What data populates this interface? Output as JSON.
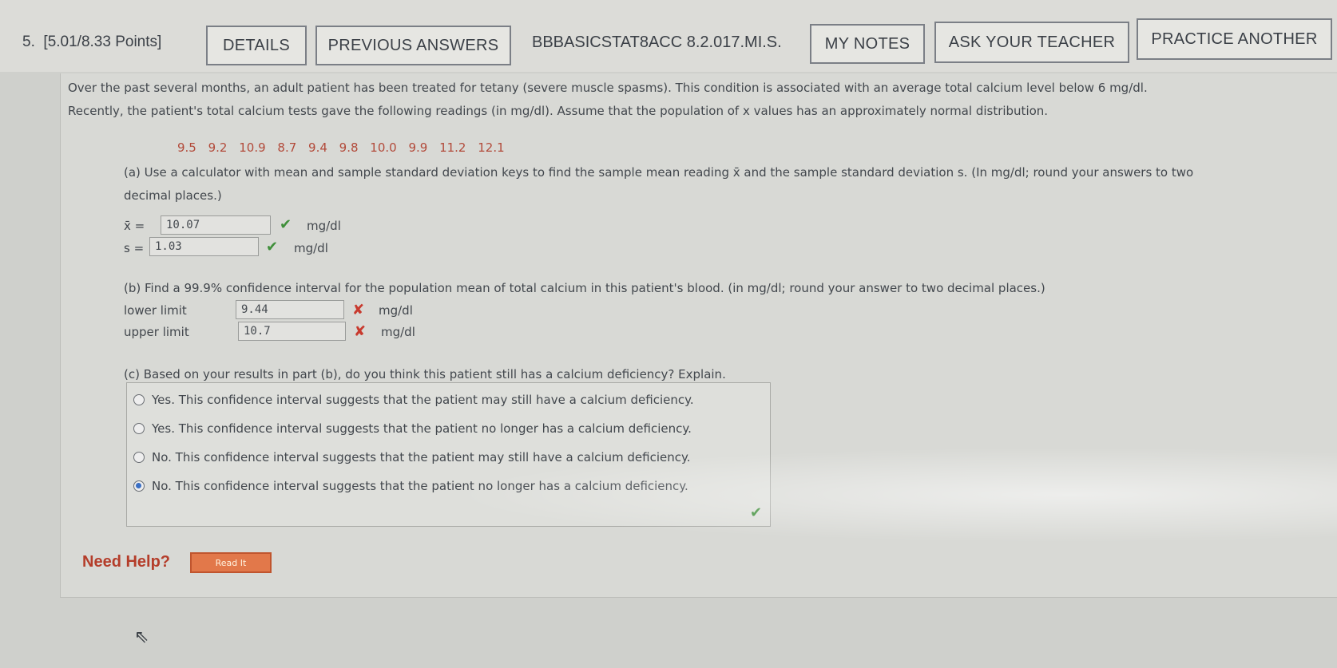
{
  "header": {
    "question_number": "5.",
    "points": "[5.01/8.33 Points]",
    "details_label": "DETAILS",
    "previous_answers_label": "PREVIOUS ANSWERS",
    "code": "BBBASICSTAT8ACC 8.2.017.MI.S.",
    "my_notes_label": "MY NOTES",
    "ask_teacher_label": "ASK YOUR TEACHER",
    "practice_another_label": "PRACTICE ANOTHER"
  },
  "problem": {
    "line1": "Over the past several months, an adult patient has been treated for tetany (severe muscle spasms). This condition is associated with an average total calcium level below 6 mg/dl.",
    "line2": "Recently, the patient's total calcium tests gave the following readings (in mg/dl). Assume that the population of x values has an approximately normal distribution.",
    "data_values": "9.5  9.2  10.9  8.7  9.4  9.8  10.0  9.9  11.2  12.1"
  },
  "part_a": {
    "line1": "(a) Use a calculator with mean and sample standard deviation keys to find the sample mean reading x̄ and the sample standard deviation s. (In mg/dl; round your answers to two",
    "line2": "decimal places.)",
    "xbar_label": "x̄ =",
    "xbar_value": "10.07",
    "s_label": "s =",
    "s_value": "1.03",
    "unit": "mg/dl"
  },
  "part_b": {
    "question": "(b) Find a 99.9% confidence interval for the population mean of total calcium in this patient's blood. (in mg/dl; round your answer to two decimal places.)",
    "lower_label": "lower limit",
    "lower_value": "9.44",
    "upper_label": "upper limit",
    "upper_value": "10.7",
    "unit": "mg/dl"
  },
  "part_c": {
    "question": "(c) Based on your results in part (b), do you think this patient still has a calcium deficiency? Explain.",
    "options": [
      "Yes. This confidence interval suggests that the patient may still have a calcium deficiency.",
      "Yes. This confidence interval suggests that the patient no longer has a calcium deficiency.",
      "No. This confidence interval suggests that the patient may still have a calcium deficiency.",
      "No. This confidence interval suggests that the patient no longer has a calcium deficiency."
    ],
    "selected_index": 3
  },
  "help": {
    "need_help_label": "Need Help?",
    "read_it_label": "Read It"
  },
  "icons": {
    "correct": "check-icon",
    "incorrect": "cross-icon",
    "cursor": "mouse-pointer-icon"
  },
  "colors": {
    "correct": "#3f8f3a",
    "incorrect": "#c83a2e",
    "data_values": "#b24a3a",
    "need_help": "#b43d2a",
    "read_it_button": "#e2784a"
  }
}
